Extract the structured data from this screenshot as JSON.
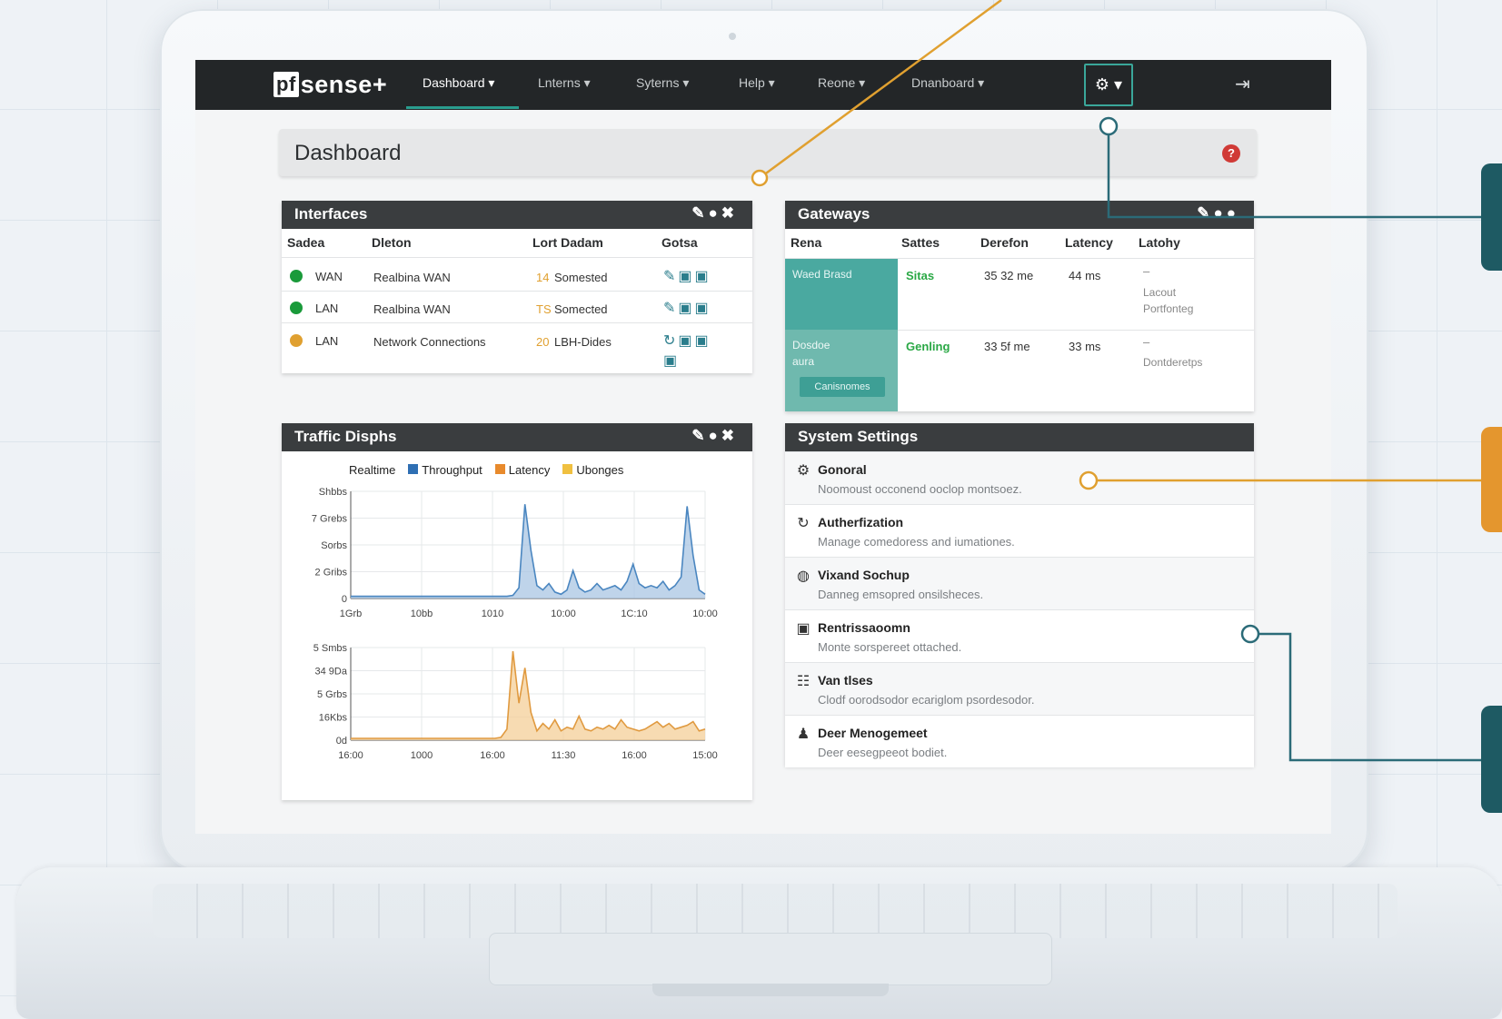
{
  "navbar": {
    "brand_badge": "pf",
    "brand_text": "sense+",
    "items": [
      {
        "label": "Dashboard ▾",
        "active": true
      },
      {
        "label": "Lnterns ▾"
      },
      {
        "label": "Syterns ▾"
      },
      {
        "label": "Help ▾"
      },
      {
        "label": "Reone ▾"
      },
      {
        "label": "Dnanboard ▾"
      }
    ],
    "gear_label": "⚙ ▾",
    "logout_icon": "logout-icon"
  },
  "page": {
    "title": "Dashboard",
    "help_glyph": "?"
  },
  "interfaces": {
    "title": "Interfaces",
    "tools": "✎●✖",
    "headers": [
      "Sadea",
      "Dleton",
      "Lort Dadam",
      "Gotsa"
    ],
    "rows": [
      {
        "status_color": "#1a9a3a",
        "name": "WAN",
        "description": "Realbina WAN",
        "count": "14",
        "detail": "Somested",
        "actions": "✎▣▣"
      },
      {
        "status_color": "#1a9a3a",
        "name": "LAN",
        "description": "Realbina WAN",
        "count": "TS",
        "detail": "Somected",
        "actions": "✎▣▣"
      },
      {
        "status_color": "#e0a030",
        "name": "LAN",
        "description": "Network Connections",
        "count": "20",
        "detail": "LBH-Dides",
        "actions": "↻▣▣"
      }
    ],
    "extra_action": "▣"
  },
  "gateways": {
    "title": "Gateways",
    "tools": "✎●●",
    "headers": [
      "Rena",
      "Sattes",
      "Derefon",
      "Latency",
      "Latohy"
    ],
    "rows": [
      {
        "name": "Waed Brasd",
        "status": "Sitas",
        "status_color": "#2aa845",
        "delay": "35 32 me",
        "latency": "44 ms",
        "info_dash": "–",
        "info1": "Lacout",
        "info2": "Portfonteg"
      },
      {
        "name": "Dosdoe",
        "name2": "aura",
        "button": "Canisnomes",
        "status": "Genling",
        "status_color": "#2aa845",
        "delay": "33 5f me",
        "latency": "33 ms",
        "info_dash": "–",
        "info1": "Dontderetps",
        "info2": ""
      }
    ]
  },
  "traffic": {
    "title": "Traffic Disphs",
    "tools": "✎●✖",
    "legend": [
      {
        "label": "Realtime",
        "color": ""
      },
      {
        "label": "Throughput",
        "color": "#2f6fb3"
      },
      {
        "label": "Latency",
        "color": "#e88a2c"
      },
      {
        "label": "Ubonges",
        "color": "#f0c040"
      }
    ]
  },
  "chart_data": [
    {
      "type": "area",
      "color": "#4a86c0",
      "fill": "#a9c6e3",
      "y_tick_labels": [
        "Shbbs",
        "7 Grebs",
        "Sorbs",
        "2 Gribs",
        "0"
      ],
      "x_tick_labels": [
        "1Grb",
        "10bb",
        "1010",
        "10:00",
        "1C:10",
        "10:00"
      ],
      "ylim": [
        0,
        100
      ],
      "values": [
        2,
        2,
        2,
        2,
        2,
        2,
        2,
        2,
        2,
        2,
        2,
        2,
        2,
        2,
        2,
        2,
        2,
        2,
        2,
        2,
        2,
        2,
        2,
        2,
        2,
        2,
        2,
        3,
        10,
        88,
        45,
        12,
        8,
        14,
        6,
        4,
        8,
        26,
        10,
        6,
        8,
        14,
        8,
        10,
        12,
        8,
        16,
        32,
        14,
        10,
        12,
        10,
        16,
        8,
        12,
        20,
        86,
        40,
        8,
        4
      ],
      "grid": true
    },
    {
      "type": "area",
      "color": "#e09a40",
      "fill": "#f4cf98",
      "y_tick_labels": [
        "5 Smbs",
        "34 9Da",
        "5 Grbs",
        "16Kbs",
        "0d"
      ],
      "x_tick_labels": [
        "16:00",
        "1000",
        "16:00",
        "11:30",
        "16:00",
        "15:00"
      ],
      "ylim": [
        0,
        100
      ],
      "values": [
        2,
        2,
        2,
        2,
        2,
        2,
        2,
        2,
        2,
        2,
        2,
        2,
        2,
        2,
        2,
        2,
        2,
        2,
        2,
        2,
        2,
        2,
        2,
        2,
        2,
        3,
        12,
        96,
        40,
        78,
        30,
        10,
        18,
        12,
        22,
        10,
        14,
        12,
        26,
        12,
        10,
        14,
        12,
        16,
        12,
        22,
        14,
        12,
        10,
        12,
        16,
        20,
        14,
        18,
        12,
        14,
        16,
        20,
        10,
        12
      ],
      "grid": true
    }
  ],
  "settings": {
    "title": "System Settings",
    "items": [
      {
        "icon": "gear-icon",
        "glyph": "⚙",
        "title": "Gonoral",
        "desc": "Noomoust occonend ooclop montsoez."
      },
      {
        "icon": "refresh-icon",
        "glyph": "↻",
        "title": "Autherfization",
        "desc": "Manage comedoress and iumationes."
      },
      {
        "icon": "globe-icon",
        "glyph": "◍",
        "title": "Vixand Sochup",
        "desc": "Danneg emsopred onsilsheces."
      },
      {
        "icon": "lock-icon",
        "glyph": "▣",
        "title": "Rentrissaoomn",
        "desc": "Monte sorspereet ottached."
      },
      {
        "icon": "users-icon",
        "glyph": "☷",
        "title": "Van tlses",
        "desc": "Clodf oorodsodor ecariglom psordesodor."
      },
      {
        "icon": "user-icon",
        "glyph": "♟",
        "title": "Deer Menogemeet",
        "desc": "Deer eesegpeeot bodiet."
      }
    ]
  },
  "colors": {
    "accent": "#2a9d8f",
    "orange": "#e0a030",
    "teal_line": "#2b6b78",
    "navbar": "#232628"
  }
}
